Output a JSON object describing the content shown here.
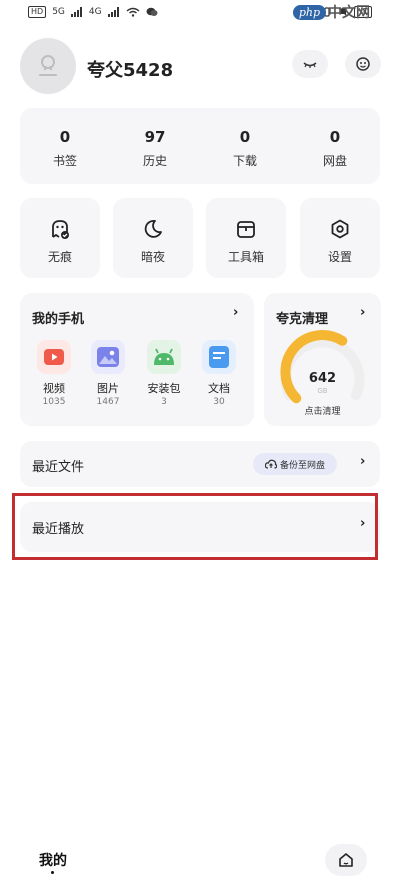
{
  "status_bar": {
    "left_items": [
      "HD",
      "5G",
      "4G"
    ],
    "right_items": [
      "HD"
    ]
  },
  "watermark": {
    "logo": "php",
    "text": "中文网"
  },
  "profile": {
    "username": "夸父5428"
  },
  "header_actions": [
    {
      "icon": "sleep-mode-icon"
    },
    {
      "icon": "message-icon"
    }
  ],
  "stats": [
    {
      "value": "0",
      "label": "书签"
    },
    {
      "value": "97",
      "label": "历史"
    },
    {
      "value": "0",
      "label": "下载"
    },
    {
      "value": "0",
      "label": "网盘"
    }
  ],
  "tools": [
    {
      "label": "无痕",
      "icon": "ghost-icon"
    },
    {
      "label": "暗夜",
      "icon": "moon-icon"
    },
    {
      "label": "工具箱",
      "icon": "toolbox-icon"
    },
    {
      "label": "设置",
      "icon": "settings-icon"
    }
  ],
  "my_phone": {
    "title": "我的手机",
    "chevron": "›",
    "items": [
      {
        "label": "视频",
        "count": "1035",
        "icon": "video-icon",
        "color": "#f05a4a"
      },
      {
        "label": "图片",
        "count": "1467",
        "icon": "image-icon",
        "color": "#6a74e0"
      },
      {
        "label": "安装包",
        "count": "3",
        "icon": "android-icon",
        "color": "#4fb96a"
      },
      {
        "label": "文档",
        "count": "30",
        "icon": "document-icon",
        "color": "#4a9af0"
      }
    ]
  },
  "cleaner": {
    "title": "夸克清理",
    "chevron": "›",
    "value": "642",
    "unit": "GB",
    "action": "点击清理",
    "gauge_fraction": 0.62,
    "gauge_color": "#f5b733"
  },
  "recent_files": {
    "label": "最近文件",
    "backup_label": "备份至网盘",
    "chevron": "›"
  },
  "recent_play": {
    "label": "最近播放",
    "chevron": "›"
  },
  "bottom_nav": {
    "me_label": "我的"
  }
}
